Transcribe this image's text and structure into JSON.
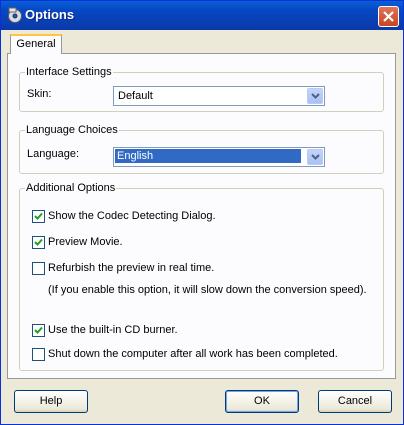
{
  "window": {
    "title": "Options",
    "app_icon": "disc-icon",
    "close_icon": "close-icon"
  },
  "tabs": [
    {
      "label": "General",
      "active": true
    }
  ],
  "interface": {
    "legend": "Interface Settings",
    "skin_label": "Skin:",
    "skin_value": "Default"
  },
  "language": {
    "legend": "Language Choices",
    "language_label": "Language:",
    "language_value": "English"
  },
  "additional": {
    "legend": "Additional Options",
    "options": [
      {
        "label": "Show the Codec Detecting Dialog.",
        "checked": true
      },
      {
        "label": "Preview Movie.",
        "checked": true
      },
      {
        "label": "Refurbish the preview in real time.",
        "checked": false
      },
      {
        "label": "Use the built-in CD burner.",
        "checked": true
      },
      {
        "label": "Shut down the computer after all work has been completed.",
        "checked": false
      }
    ],
    "note": "(If you enable this option, it will slow down the conversion speed)."
  },
  "buttons": {
    "help": "Help",
    "ok": "OK",
    "cancel": "Cancel"
  },
  "colors": {
    "titlebar": "#0a5fd8",
    "selection": "#316ac5",
    "close": "#c8451e",
    "tab_accent": "#ffc83c"
  }
}
